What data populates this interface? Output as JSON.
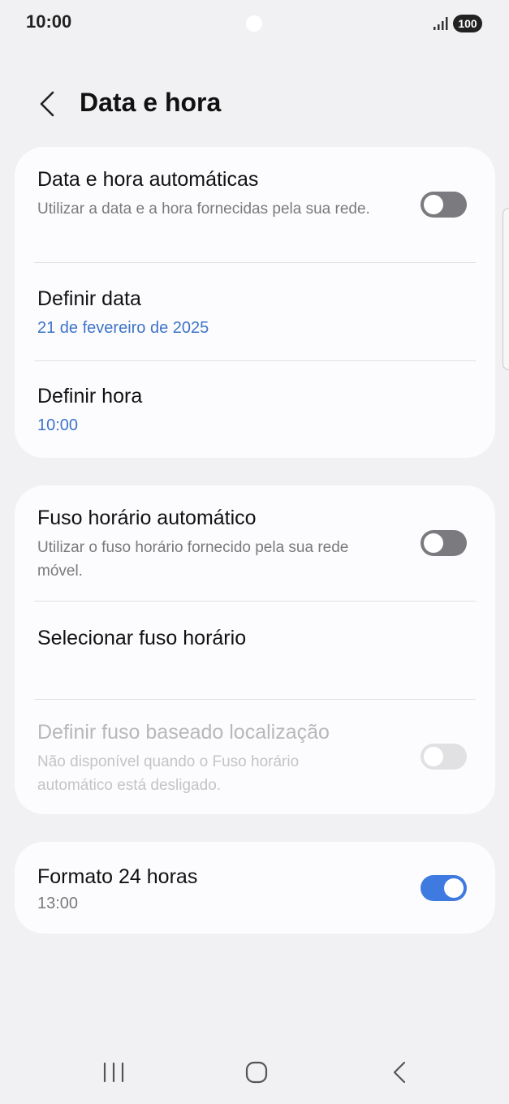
{
  "status_bar": {
    "time": "10:00",
    "battery": "100"
  },
  "header": {
    "title": "Data e hora",
    "back_icon": "chevron-left-icon"
  },
  "card1": {
    "auto_datetime": {
      "title": "Data e hora automáticas",
      "subtitle": "Utilizar a data e a hora fornecidas pela sua rede.",
      "toggle_on": false
    },
    "set_date": {
      "title": "Definir data",
      "value": "21 de fevereiro de 2025"
    },
    "set_time": {
      "title": "Definir hora",
      "value": "10:00"
    }
  },
  "card2": {
    "auto_timezone": {
      "title": "Fuso horário automático",
      "subtitle": "Utilizar o fuso horário fornecido pela sua rede móvel.",
      "toggle_on": false
    },
    "select_timezone": {
      "title": "Selecionar fuso horário"
    },
    "location_timezone": {
      "title": "Definir fuso baseado localização",
      "subtitle": "Não disponível quando o Fuso horário automático está desligado.",
      "toggle_on": false,
      "enabled": false
    }
  },
  "card3": {
    "format_24h": {
      "title": "Formato 24 horas",
      "subtitle": "13:00",
      "toggle_on": true
    }
  },
  "colors": {
    "accent": "#3e7ae0",
    "value_text": "#3e74c8",
    "background": "#f1f1f3",
    "card": "#fcfcfe"
  },
  "nav": {
    "recents_icon": "recents-icon",
    "home_icon": "home-icon",
    "back_icon": "back-icon"
  }
}
